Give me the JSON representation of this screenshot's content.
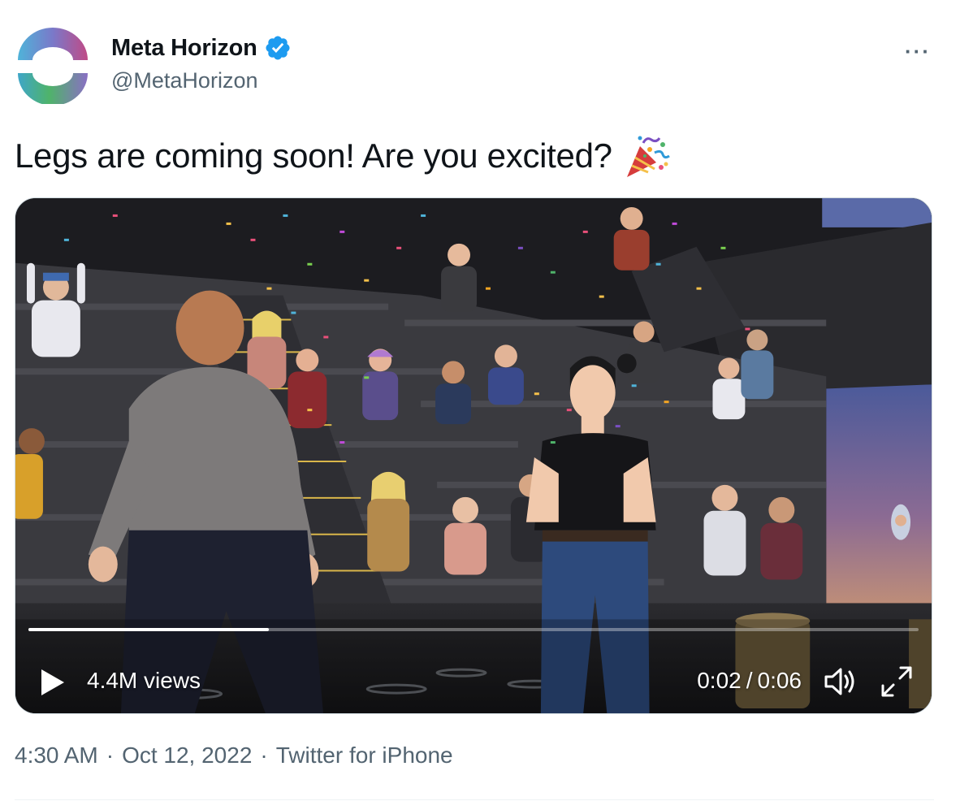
{
  "author": {
    "display_name": "Meta Horizon",
    "handle": "@MetaHorizon",
    "verified_icon": "verified-badge-icon",
    "avatar_icon": "meta-horizon-logo"
  },
  "menu": {
    "more_label": "···"
  },
  "tweet": {
    "text": "Legs are coming soon! Are you excited?",
    "emoji_icon": "party-popper-icon"
  },
  "video": {
    "views_text": "4.4M views",
    "current_time": "0:02",
    "separator": "/",
    "duration": "0:06",
    "progress_fraction": 0.27,
    "play_icon": "play-icon",
    "volume_icon": "volume-icon",
    "fullscreen_icon": "fullscreen-icon"
  },
  "footer": {
    "time": "4:30 AM",
    "dot1": "·",
    "date": "Oct 12, 2022",
    "dot2": "·",
    "source": "Twitter for iPhone"
  },
  "colors": {
    "primary_text": "#0f1419",
    "secondary_text": "#536471",
    "verified_blue": "#1d9bf0",
    "border": "#cfd9de"
  }
}
